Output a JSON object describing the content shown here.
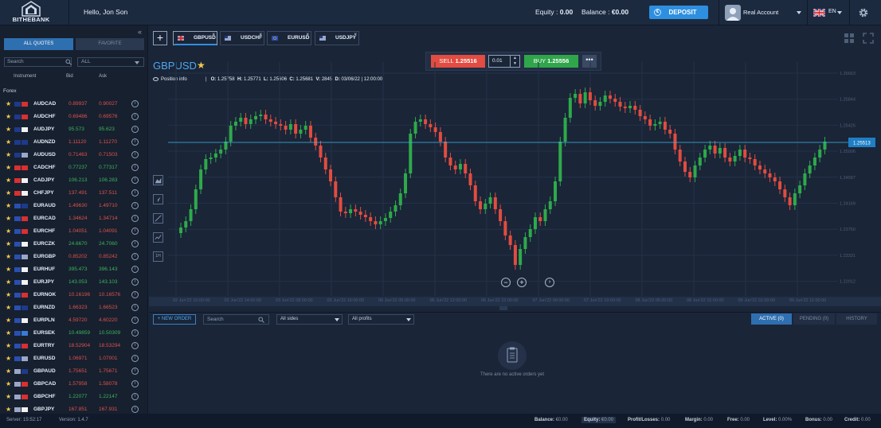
{
  "brand": {
    "name": "BITHEBANK"
  },
  "header": {
    "greeting": "Hello, Jon Son",
    "equity_label": "Equity : ",
    "equity_value": "0.00",
    "balance_label": "Balance : ",
    "balance_value": "€0.00",
    "deposit_label": "DEPOSIT",
    "account_label": "Real Account",
    "language": "EN"
  },
  "watchlist": {
    "tabs": {
      "all": "ALL QUOTES",
      "favorite": "FAVORITE"
    },
    "search_placeholder": "Search",
    "filter_value": "ALL",
    "columns": {
      "instrument": "Instrument",
      "bid": "Bid",
      "ask": "Ask"
    },
    "group_label": "Forex",
    "rows": [
      {
        "symbol": "AUDCAD",
        "bid": "0.89937",
        "ask": "0.90027",
        "dir": "down",
        "f1": "#1e3a8a",
        "f2": "#d93030"
      },
      {
        "symbol": "AUDCHF",
        "bid": "0.69486",
        "ask": "0.69576",
        "dir": "down",
        "f1": "#1e3a8a",
        "f2": "#d93030"
      },
      {
        "symbol": "AUDJPY",
        "bid": "95.573",
        "ask": "95.623",
        "dir": "up",
        "f1": "#1e3a8a",
        "f2": "#f2f2f2"
      },
      {
        "symbol": "AUDNZD",
        "bid": "1.11120",
        "ask": "1.11270",
        "dir": "down",
        "f1": "#1e3a8a",
        "f2": "#1e3a8a"
      },
      {
        "symbol": "AUDUSD",
        "bid": "0.71463",
        "ask": "0.71503",
        "dir": "down",
        "f1": "#1e3a8a",
        "f2": "#9aa7c7"
      },
      {
        "symbol": "CADCHF",
        "bid": "0.77237",
        "ask": "0.77317",
        "dir": "up",
        "f1": "#d93030",
        "f2": "#d93030"
      },
      {
        "symbol": "CADJPY",
        "bid": "106.213",
        "ask": "106.283",
        "dir": "up",
        "f1": "#d93030",
        "f2": "#f2f2f2"
      },
      {
        "symbol": "CHFJPY",
        "bid": "137.491",
        "ask": "137.511",
        "dir": "down",
        "f1": "#d93030",
        "f2": "#f2f2f2"
      },
      {
        "symbol": "EURAUD",
        "bid": "1.49630",
        "ask": "1.49710",
        "dir": "down",
        "f1": "#2a4fb0",
        "f2": "#1e3a8a"
      },
      {
        "symbol": "EURCAD",
        "bid": "1.34624",
        "ask": "1.34714",
        "dir": "down",
        "f1": "#2a4fb0",
        "f2": "#d93030"
      },
      {
        "symbol": "EURCHF",
        "bid": "1.04051",
        "ask": "1.04091",
        "dir": "down",
        "f1": "#2a4fb0",
        "f2": "#d93030"
      },
      {
        "symbol": "EURCZK",
        "bid": "24.6670",
        "ask": "24.7060",
        "dir": "up",
        "f1": "#2a4fb0",
        "f2": "#f2f2f2"
      },
      {
        "symbol": "EURGBP",
        "bid": "0.85202",
        "ask": "0.85242",
        "dir": "down",
        "f1": "#2a4fb0",
        "f2": "#9aa7c7"
      },
      {
        "symbol": "EURHUF",
        "bid": "395.473",
        "ask": "396.143",
        "dir": "up",
        "f1": "#2a4fb0",
        "f2": "#f2f2f2"
      },
      {
        "symbol": "EURJPY",
        "bid": "143.053",
        "ask": "143.103",
        "dir": "up",
        "f1": "#2a4fb0",
        "f2": "#f2f2f2"
      },
      {
        "symbol": "EURNOK",
        "bid": "10.16196",
        "ask": "10.16576",
        "dir": "down",
        "f1": "#2a4fb0",
        "f2": "#d93030"
      },
      {
        "symbol": "EURNZD",
        "bid": "1.66323",
        "ask": "1.66523",
        "dir": "down",
        "f1": "#2a4fb0",
        "f2": "#1e3a8a"
      },
      {
        "symbol": "EURPLN",
        "bid": "4.59720",
        "ask": "4.60220",
        "dir": "down",
        "f1": "#2a4fb0",
        "f2": "#f2f2f2"
      },
      {
        "symbol": "EURSEK",
        "bid": "10.49859",
        "ask": "10.50309",
        "dir": "up",
        "f1": "#2a4fb0",
        "f2": "#3a7bd5"
      },
      {
        "symbol": "EURTRY",
        "bid": "18.52904",
        "ask": "18.53294",
        "dir": "down",
        "f1": "#2a4fb0",
        "f2": "#d93030"
      },
      {
        "symbol": "EURUSD",
        "bid": "1.06971",
        "ask": "1.07001",
        "dir": "down",
        "f1": "#2a4fb0",
        "f2": "#9aa7c7"
      },
      {
        "symbol": "GBPAUD",
        "bid": "1.75651",
        "ask": "1.75671",
        "dir": "down",
        "f1": "#9aa7c7",
        "f2": "#1e3a8a"
      },
      {
        "symbol": "GBPCAD",
        "bid": "1.57958",
        "ask": "1.58078",
        "dir": "down",
        "f1": "#9aa7c7",
        "f2": "#d93030"
      },
      {
        "symbol": "GBPCHF",
        "bid": "1.22077",
        "ask": "1.22147",
        "dir": "up",
        "f1": "#9aa7c7",
        "f2": "#d93030"
      },
      {
        "symbol": "GBPJPY",
        "bid": "167.851",
        "ask": "167.931",
        "dir": "down",
        "f1": "#9aa7c7",
        "f2": "#f2f2f2"
      }
    ]
  },
  "chart": {
    "tabs": [
      {
        "symbol": "GBPUSD",
        "active": true
      },
      {
        "symbol": "USDCHF",
        "active": false
      },
      {
        "symbol": "EURUSD",
        "active": false
      },
      {
        "symbol": "USDJPY",
        "active": false
      }
    ],
    "title": "GBPUSD",
    "position_info": "Position info",
    "ohlc": {
      "o": "1.25758",
      "h": "1.25771",
      "l": "1.25606",
      "c": "1.25681",
      "v": "2845",
      "d": "03/06/22 | 12:00:00"
    },
    "sell_label": "SELL",
    "sell_price": "1.25516",
    "lot": "0.01",
    "buy_label": "BUY",
    "buy_price": "1.25556",
    "current_price": "1.25513",
    "price_ticks": [
      "1.26663",
      "1.25844",
      "1.25425",
      "1.25006",
      "1.24587",
      "1.24169",
      "1.23750",
      "1.23331",
      "1.22912"
    ],
    "time_ticks": [
      "02 Jun'22 10:00:00",
      "02 Jun'22 14:00:00",
      "03 Jun'22 08:00:00",
      "03 Jun'22 16:00:00",
      "06 Jun'22 05:00:00",
      "06 Jun'22 12:00:00",
      "06 Jun'22 22:00:00",
      "07 Jun'22 09:00:00",
      "07 Jun'22 19:00:00",
      "08 Jun'22 05:00:00",
      "08 Jun'22 15:00:00",
      "09 Jun'22 01:00:00",
      "09 Jun'22 11:00:00"
    ],
    "colors": {
      "up": "#2eaa4a",
      "down": "#e24c3f",
      "price_line": "#3fb7e8"
    }
  },
  "orders": {
    "new_order": "+ NEW ORDER",
    "search_placeholder": "Search",
    "sides_filter": "All sides",
    "profits_filter": "All profits",
    "tabs": {
      "active": "ACTIVE (0)",
      "pending": "PENDING (0)",
      "history": "HISTORY"
    },
    "empty_text": "There are no active orders yet"
  },
  "status": {
    "server_label": "Server:",
    "server_time": "15:52:17",
    "version_label": "Version:",
    "version": "1.4.7",
    "balance_label": "Balance:",
    "balance": "€0.00",
    "equity_label": "Equity:",
    "equity": "€0.00",
    "pl_label": "Profit/Losses:",
    "pl": "0.00",
    "margin_label": "Margin:",
    "margin": "0.00",
    "free_label": "Free:",
    "free": "0.00",
    "level_label": "Level:",
    "level": "0.00%",
    "bonus_label": "Bonus:",
    "bonus": "0.00",
    "credit_label": "Credit:",
    "credit": "0.00"
  }
}
